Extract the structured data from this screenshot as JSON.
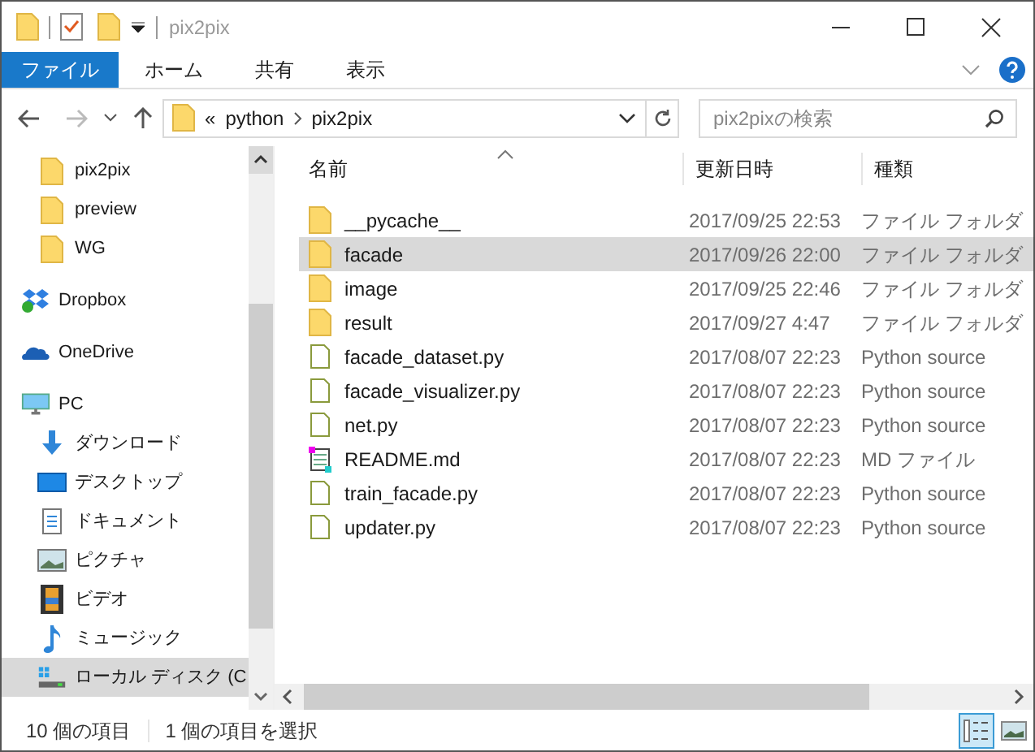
{
  "window": {
    "title": "pix2pix"
  },
  "ribbon_tabs": [
    {
      "label": "ファイル",
      "selected": true
    },
    {
      "label": "ホーム",
      "selected": false
    },
    {
      "label": "共有",
      "selected": false
    },
    {
      "label": "表示",
      "selected": false
    }
  ],
  "address_bar": {
    "overflow": "«",
    "segments": [
      "python",
      "pix2pix"
    ]
  },
  "search": {
    "placeholder": "pix2pixの検索"
  },
  "sidebar": {
    "items": [
      {
        "label": "pix2pix",
        "kind": "folder",
        "selected": false
      },
      {
        "label": "preview",
        "kind": "folder",
        "selected": false
      },
      {
        "label": "WG",
        "kind": "folder",
        "selected": false
      },
      {
        "label": "Dropbox",
        "kind": "dropbox",
        "selected": false
      },
      {
        "label": "OneDrive",
        "kind": "onedrive",
        "selected": false
      },
      {
        "label": "PC",
        "kind": "pc",
        "selected": false,
        "children": [
          {
            "label": "ダウンロード",
            "kind": "download",
            "selected": false
          },
          {
            "label": "デスクトップ",
            "kind": "desktop",
            "selected": false
          },
          {
            "label": "ドキュメント",
            "kind": "documents",
            "selected": false
          },
          {
            "label": "ピクチャ",
            "kind": "pictures",
            "selected": false
          },
          {
            "label": "ビデオ",
            "kind": "videos",
            "selected": false
          },
          {
            "label": "ミュージック",
            "kind": "music",
            "selected": false
          },
          {
            "label": "ローカル ディスク (C",
            "kind": "drive",
            "selected": true
          }
        ]
      }
    ]
  },
  "table": {
    "columns": [
      "名前",
      "更新日時",
      "種類"
    ],
    "rows": [
      {
        "name": "__pycache__",
        "date": "2017/09/25 22:53",
        "type": "ファイル フォルダ",
        "kind": "folder",
        "selected": false
      },
      {
        "name": "facade",
        "date": "2017/09/26 22:00",
        "type": "ファイル フォルダ",
        "kind": "folder",
        "selected": true
      },
      {
        "name": "image",
        "date": "2017/09/25 22:46",
        "type": "ファイル フォルダ",
        "kind": "folder",
        "selected": false
      },
      {
        "name": "result",
        "date": "2017/09/27 4:47",
        "type": "ファイル フォルダ",
        "kind": "folder",
        "selected": false
      },
      {
        "name": "facade_dataset.py",
        "date": "2017/08/07 22:23",
        "type": "Python source",
        "kind": "file",
        "selected": false
      },
      {
        "name": "facade_visualizer.py",
        "date": "2017/08/07 22:23",
        "type": "Python source",
        "kind": "file",
        "selected": false
      },
      {
        "name": "net.py",
        "date": "2017/08/07 22:23",
        "type": "Python source",
        "kind": "file",
        "selected": false
      },
      {
        "name": "README.md",
        "date": "2017/08/07 22:23",
        "type": "MD ファイル",
        "kind": "text",
        "selected": false
      },
      {
        "name": "train_facade.py",
        "date": "2017/08/07 22:23",
        "type": "Python source",
        "kind": "file",
        "selected": false
      },
      {
        "name": "updater.py",
        "date": "2017/08/07 22:23",
        "type": "Python source",
        "kind": "file",
        "selected": false
      }
    ]
  },
  "status_bar": {
    "item_count": "10 個の項目",
    "selection": "1 個の項目を選択"
  },
  "view_modes": [
    {
      "kind": "details",
      "selected": true
    },
    {
      "kind": "thumbnails",
      "selected": false
    }
  ]
}
